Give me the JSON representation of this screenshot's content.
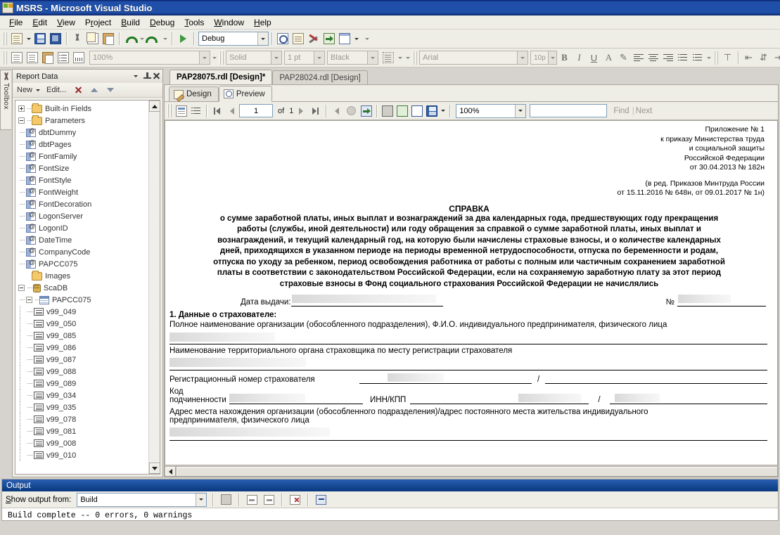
{
  "window": {
    "title": "MSRS - Microsoft Visual Studio"
  },
  "menu": {
    "items": [
      "File",
      "Edit",
      "View",
      "Project",
      "Build",
      "Debug",
      "Tools",
      "Window",
      "Help"
    ]
  },
  "toolbar_main": {
    "config_value": "Debug",
    "icons": [
      "new-project-icon",
      "save-icon",
      "save-all-icon",
      "cut-icon",
      "copy-icon",
      "paste-icon",
      "undo-icon",
      "redo-icon",
      "start-debugging-icon",
      "find-in-files-icon",
      "properties-window-icon",
      "tools-icon",
      "navigate-icon",
      "command-window-icon"
    ]
  },
  "toolbar_report": {
    "zoom_value": "100%",
    "line_style_value": "Solid",
    "line_width_value": "1 pt",
    "line_color_value": "Black",
    "icons": [
      "report-icon",
      "report-body-icon",
      "report-group-icon",
      "report-list-icon",
      "ruler-icon",
      "border-icon"
    ]
  },
  "toolbar_format": {
    "font_family_value": "Arial",
    "font_size_value": "10p",
    "buttons": [
      "bold",
      "italic",
      "underline",
      "font-color",
      "highlight",
      "align-left",
      "align-center",
      "align-right",
      "numbered-list",
      "bulleted-list"
    ]
  },
  "toolbox": {
    "label": "Toolbox"
  },
  "report_data": {
    "title": "Report Data",
    "toolbar": {
      "new": "New",
      "edit": "Edit...",
      "delete_icon": "delete-icon",
      "up_icon": "move-up-icon",
      "down_icon": "move-down-icon"
    },
    "tree": [
      {
        "label": "Built-in Fields",
        "kind": "folder",
        "depth": 0,
        "expander": "plus"
      },
      {
        "label": "Parameters",
        "kind": "folder",
        "depth": 0,
        "expander": "minus"
      },
      {
        "label": "dbtDummy",
        "kind": "param",
        "depth": 1
      },
      {
        "label": "dbtPages",
        "kind": "param",
        "depth": 1
      },
      {
        "label": "FontFamily",
        "kind": "param",
        "depth": 1
      },
      {
        "label": "FontSize",
        "kind": "param",
        "depth": 1
      },
      {
        "label": "FontStyle",
        "kind": "param",
        "depth": 1
      },
      {
        "label": "FontWeight",
        "kind": "param",
        "depth": 1
      },
      {
        "label": "FontDecoration",
        "kind": "param",
        "depth": 1
      },
      {
        "label": "LogonServer",
        "kind": "param",
        "depth": 1
      },
      {
        "label": "LogonID",
        "kind": "param",
        "depth": 1
      },
      {
        "label": "DateTime",
        "kind": "param",
        "depth": 1
      },
      {
        "label": "CompanyCode",
        "kind": "param",
        "depth": 1
      },
      {
        "label": "PAPCC075",
        "kind": "param",
        "depth": 1
      },
      {
        "label": "Images",
        "kind": "folder",
        "depth": 0,
        "expander": "none"
      },
      {
        "label": "ScaDB",
        "kind": "db",
        "depth": 0,
        "expander": "minus"
      },
      {
        "label": "PAPCC075",
        "kind": "table",
        "depth": 1,
        "expander": "minus"
      },
      {
        "label": "v99_049",
        "kind": "field",
        "depth": 2
      },
      {
        "label": "v99_050",
        "kind": "field",
        "depth": 2
      },
      {
        "label": "v99_085",
        "kind": "field",
        "depth": 2
      },
      {
        "label": "v99_086",
        "kind": "field",
        "depth": 2
      },
      {
        "label": "v99_087",
        "kind": "field",
        "depth": 2
      },
      {
        "label": "v99_088",
        "kind": "field",
        "depth": 2
      },
      {
        "label": "v99_089",
        "kind": "field",
        "depth": 2
      },
      {
        "label": "v99_034",
        "kind": "field",
        "depth": 2
      },
      {
        "label": "v99_035",
        "kind": "field",
        "depth": 2
      },
      {
        "label": "v99_078",
        "kind": "field",
        "depth": 2
      },
      {
        "label": "v99_081",
        "kind": "field",
        "depth": 2
      },
      {
        "label": "v99_008",
        "kind": "field",
        "depth": 2
      },
      {
        "label": "v99_010",
        "kind": "field",
        "depth": 2
      }
    ]
  },
  "doc_tabs": [
    {
      "label": "PAP28075.rdl [Design]*",
      "active": true
    },
    {
      "label": "PAP28024.rdl [Design]",
      "active": false
    }
  ],
  "view_tabs": [
    {
      "label": "Design",
      "icon": "design-icon",
      "active": false
    },
    {
      "label": "Preview",
      "icon": "preview-icon",
      "active": true
    }
  ],
  "preview_toolbar": {
    "page_current": "1",
    "of_label": "of",
    "page_total": "1",
    "zoom_value": "100%",
    "find_label": "Find",
    "next_label": "Next",
    "find_value": ""
  },
  "report": {
    "header_right": [
      "Приложение № 1",
      "к приказу Министерства труда",
      "и социальной защиты",
      "Российской Федерации",
      "от 30.04.2013 № 182н"
    ],
    "header_right_2": [
      "(в ред. Приказов Минтруда России",
      "от 15.11.2016 № 648н, от 09.01.2017 № 1н)"
    ],
    "title": "СПРАВКА",
    "subtitle_lines": [
      "о сумме заработной платы, иных выплат и вознаграждений за два календарных года, предшествующих году прекращения",
      "работы (службы, иной деятельности) или году обращения за справкой о сумме заработной платы, иных выплат и",
      "вознаграждений, и текущий календарный год, на которую были начислены страховые взносы, и о количестве календарных",
      "дней, приходящихся в указанном периоде на периоды временной нетрудоспособности, отпуска по беременности и родам,",
      "отпуска по уходу за ребенком, период освобождения работника от работы с полным или частичным сохранением заработной",
      "платы в соответствии с законодательством Российской Федерации, если на сохраняемую заработную плату за этот период",
      "страховые взносы в Фонд социального страхования Российской Федерации не начислялись"
    ],
    "date_label": "Дата выдачи:",
    "number_label": "№",
    "section1_title": "1. Данные о страхователе:",
    "org_name_label": "Полное наименование организации (обособленного подразделения), Ф.И.О.  индивидуального предпринимателя, физического лица",
    "territorial_label": "Наименование территориального органа страховщика по месту регистрации страхователя",
    "reg_number_label": "Регистрационный номер страхователя",
    "subordination_label": "Код подчиненности",
    "inn_kpp_label": "ИНН/КПП",
    "slash": "/",
    "address_label_line1": "Адрес места нахождения организации (обособленного подразделения)/адрес постоянного места жительства индивидуального",
    "address_label_line2": "предпринимателя, физического лица"
  },
  "output": {
    "title": "Output",
    "show_from_label": "Show output from:",
    "show_from_value": "Build",
    "text": "Build complete -- 0 errors, 0 warnings"
  },
  "colors": {
    "titlebar": "#1f4fa8",
    "chrome": "#eeede6",
    "panel_border": "#a9a69e",
    "output_title": "#0a4a9e"
  }
}
